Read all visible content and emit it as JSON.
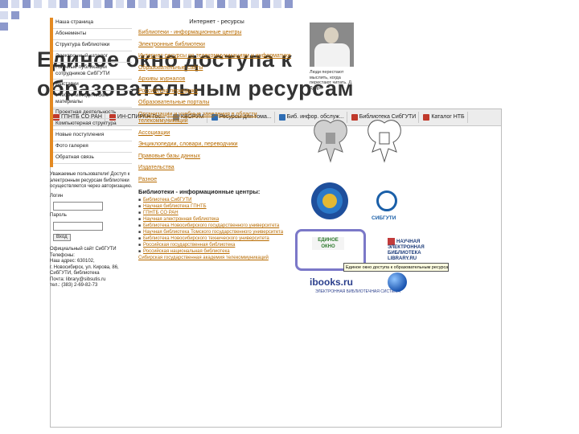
{
  "slide": {
    "title_line1": "Единое окно доступа к",
    "title_line2": "образовательным ресурсам"
  },
  "browser": {
    "tabs": [
      {
        "label": "ГПНТБ СО РАН",
        "icon": "red-square-icon",
        "color": "#c0392b"
      },
      {
        "label": "ИН-СПИРАН Гос...",
        "icon": "red-square-icon",
        "color": "#c0392b"
      },
      {
        "label": "КВОРУМ",
        "icon": "grey-square-icon",
        "color": "#7f7f7f"
      },
      {
        "label": "Ресурсы для тома...",
        "icon": "blue-square-icon",
        "color": "#2e6db4"
      },
      {
        "label": "Биб. инфор. обслуж...",
        "icon": "blue-square-icon",
        "color": "#2e6db4"
      },
      {
        "label": "Библиотека СибГУТИ",
        "icon": "red-square-icon",
        "color": "#c0392b"
      },
      {
        "label": "Каталог НТБ",
        "icon": "red-square-icon",
        "color": "#c0392b"
      }
    ]
  },
  "left_nav": {
    "items": [
      "Наша страница",
      "Абонементы",
      "Структура библиотеки",
      "Электронный каталог",
      "Научные публикации сотрудников СибГУТИ",
      "Выставки",
      "Учебно-методические материалы",
      "Проектная деятельность",
      "Компьютерная структура",
      "Новые поступления",
      "Фото галерея",
      "Обратная связь"
    ],
    "notice": "Уважаемые пользователи! Доступ к электронным ресурсам библиотеки осуществляется через авторизацию.",
    "login_label": "Логин",
    "password_label": "Пароль",
    "button_label": "Вход",
    "footer_lines": [
      "Официальный сайт СибГУТИ",
      "Телефоны:",
      "Наш адрес: 630102,",
      "г. Новосибирск, ул. Кирова, 86,",
      "СибГУТИ, библиотека",
      "Почта: library@sibsutis.ru",
      "тел.: (383) 2-69-82-73"
    ]
  },
  "center": {
    "header": "Интернет - ресурсы",
    "links": [
      "Библиотеки - информационные центры",
      "Электронные библиотеки",
      "Интернет-ресурсы по телекоммуникациям и информатике",
      "Образовательные сайты",
      "Архивы журналов",
      "Российская периодика",
      "Образовательные порталы",
      "Организации и учебные заведения в области телекоммуникаций",
      "Ассоциации",
      "Энциклопедии, словари, переводчики",
      "Правовые базы данных",
      "Издательства",
      "Разное"
    ],
    "section_title": "Библиотеки - информационные центры:",
    "bullets": [
      "Библиотека СибГУТИ",
      "Научная библиотека ГПНТБ",
      "ГПНТБ СО РАН",
      "Научная электронная библиотека",
      "Библиотека Новосибирского государственного университета",
      "Научная библиотека Томского государственного университета",
      "Библиотека Новосибирского технического университета",
      "Российская государственная библиотека",
      "Российская национальная библиотека"
    ],
    "bottom_link": "Сибирская государственная академия телекоммуникаций"
  },
  "right": {
    "quote": "Люди перестают мыслить, когда перестают читать. Д. Дидро",
    "sibguti_label": "СИБГУТИ",
    "edinoe_label": "ЕДИНОЕ ОКНО",
    "nelib_label": "НАУЧНАЯ ЭЛЕКТРОННАЯ БИБЛИОТЕКА LIBRARY.RU",
    "tooltip": "Единое окно доступа к образовательным ресурсам",
    "ibooks_label": "ibooks.ru",
    "ibooks_sub": "ЭЛЕКТРОННАЯ БИБЛИОТЕЧНАЯ СИСТЕМА"
  },
  "colors": {
    "accent_orange": "#e48a22",
    "link_color": "#b86b00",
    "highlight_frame": "#7b78c8",
    "title_color": "#333333",
    "corner_square_light": "#d6dcef",
    "corner_square_dark": "#8d99cc"
  }
}
